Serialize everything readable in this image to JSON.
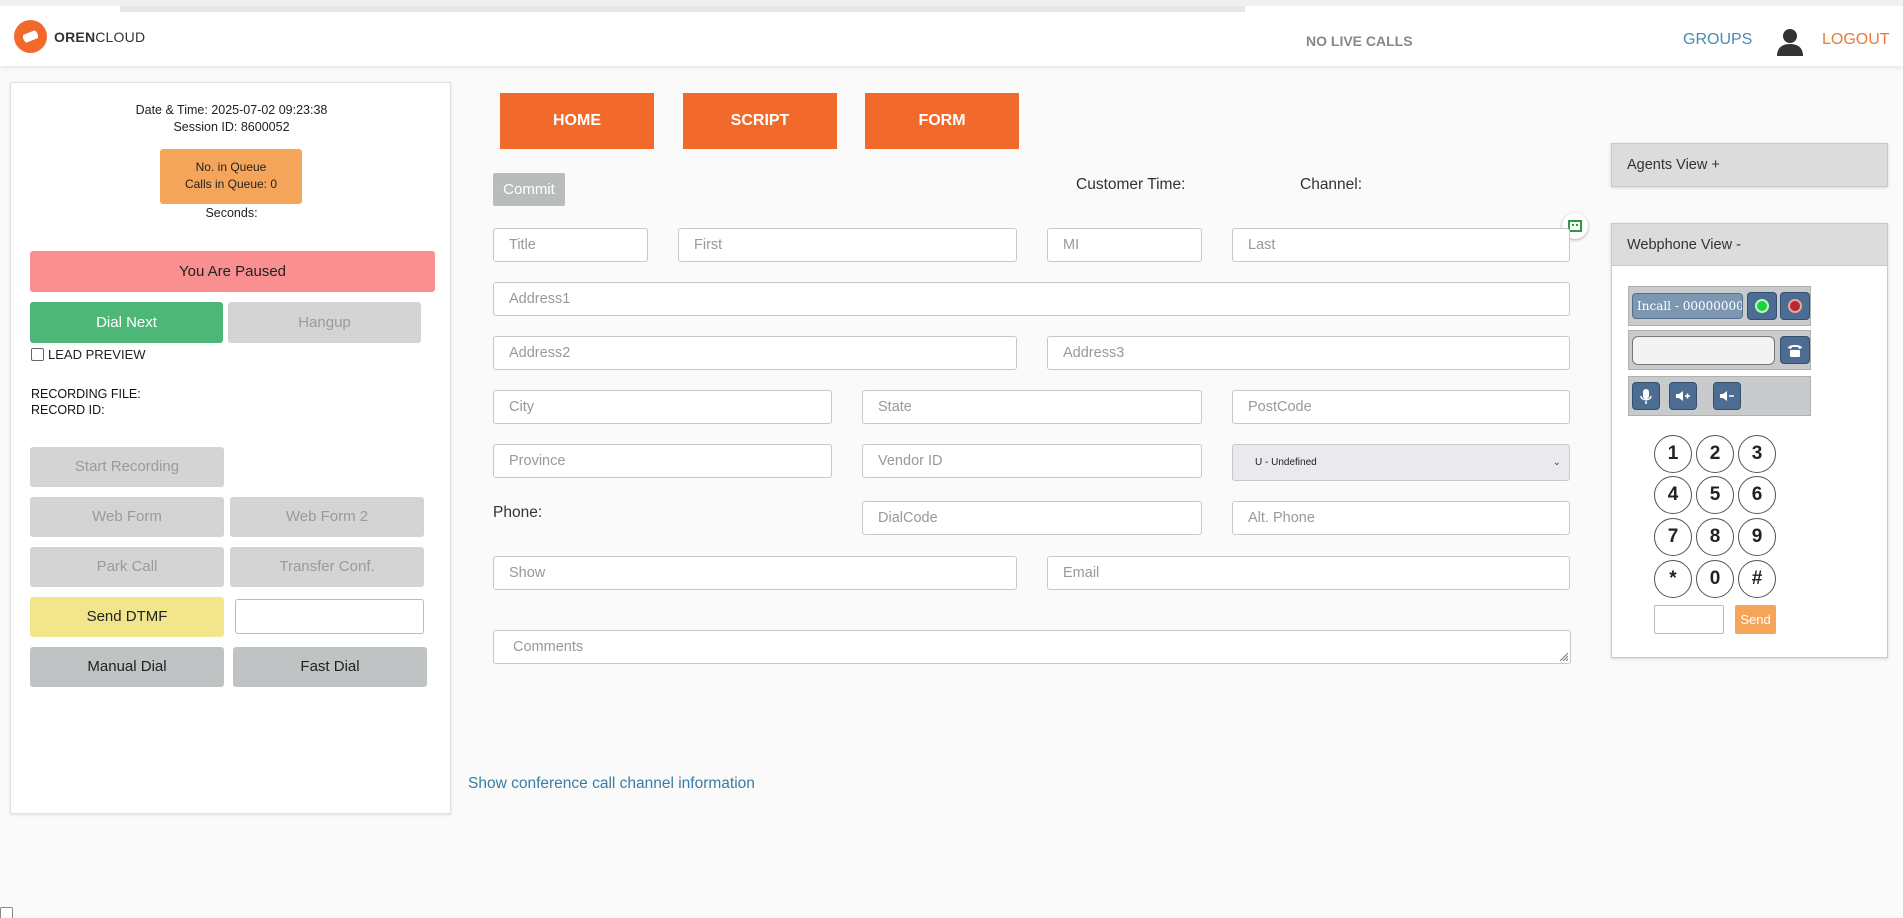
{
  "header": {
    "logo_bold": "OREN",
    "logo_light": "CLOUD",
    "live_calls": "NO LIVE CALLS",
    "groups": "GROUPS",
    "logout": "LOGOUT"
  },
  "session": {
    "datetime": "Date & Time: 2025-07-02 09:23:38",
    "session_id": "Session ID: 8600052",
    "queue_line1": "No. in Queue",
    "queue_line2": "Calls in Queue: 0",
    "seconds": "Seconds:"
  },
  "left": {
    "paused": "You Are Paused",
    "dial_next": "Dial Next",
    "hangup": "Hangup",
    "lead_preview": "LEAD PREVIEW",
    "recording_file": "RECORDING FILE:",
    "record_id": "RECORD ID:",
    "start_recording": "Start Recording",
    "web_form": "Web Form",
    "web_form_2": "Web Form 2",
    "park_call": "Park Call",
    "transfer_conf": "Transfer Conf.",
    "send_dtmf": "Send DTMF",
    "manual_dial": "Manual Dial",
    "fast_dial": "Fast Dial"
  },
  "tabs": {
    "home": "HOME",
    "script": "SCRIPT",
    "form": "FORM"
  },
  "form": {
    "commit": "Commit",
    "customer_time": "Customer Time:",
    "channel": "Channel:",
    "phone_label": "Phone:",
    "placeholders": {
      "title": "Title",
      "first": "First",
      "mi": "MI",
      "last": "Last",
      "address1": "Address1",
      "address2": "Address2",
      "address3": "Address3",
      "city": "City",
      "state": "State",
      "postcode": "PostCode",
      "province": "Province",
      "vendor_id": "Vendor ID",
      "dialcode": "DialCode",
      "alt_phone": "Alt. Phone",
      "show": "Show",
      "email": "Email",
      "comments": "Comments"
    },
    "gender_selected": "U - Undefined",
    "conference_link": "Show conference call channel information"
  },
  "right": {
    "agents_view": "Agents View +",
    "webphone_view": "Webphone View -",
    "incall_display": "Incall - 00000000",
    "keys": [
      "1",
      "2",
      "3",
      "4",
      "5",
      "6",
      "7",
      "8",
      "9",
      "*",
      "0",
      "#"
    ],
    "send": "Send"
  },
  "colors": {
    "brand_orange": "#f26a2b",
    "paused_red": "#f98f8f",
    "dial_green": "#4cb776",
    "dtmf_yellow": "#f1e68c",
    "queue_orange": "#f5a55a",
    "link_blue": "#3a7ca5"
  }
}
